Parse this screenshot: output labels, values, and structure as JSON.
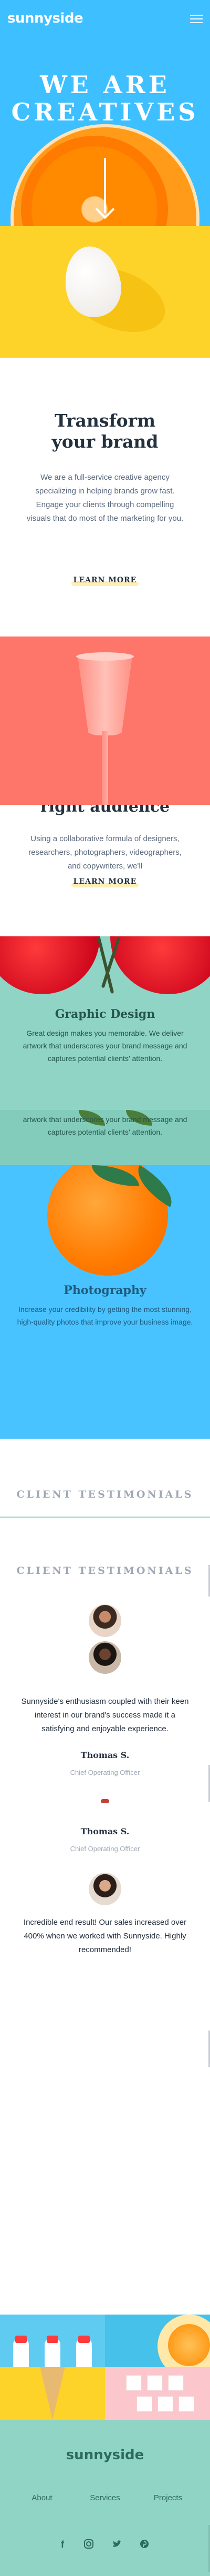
{
  "header": {
    "logo": "sunnyside"
  },
  "hero": {
    "title_line1": "WE ARE",
    "title_line2": "CREATIVES"
  },
  "transform": {
    "title_line1": "Transform",
    "title_line2": "your brand",
    "text": "We are a full-service creative agency specializing in helping brands grow fast. Engage your clients through compelling visuals that do most of the marketing for you.",
    "cta": "LEARN MORE"
  },
  "standout": {
    "title_partial": "right audience",
    "text": "Using a collaborative formula of designers, researchers, photographers, videographers, and copywriters, we'll",
    "cta": "LEARN MORE"
  },
  "graphic_design": {
    "title": "Graphic Design",
    "text": "Great design makes you memorable. We deliver artwork that underscores your brand message and captures potential clients' attention.",
    "text_repeat": "artwork that underscores your brand message and captures potential clients' attention."
  },
  "photography": {
    "title": "Photography",
    "text": "Increase your credibility by getting the most stunning, high-quality photos that improve your business image."
  },
  "testimonials": {
    "heading": "CLIENT TESTIMONIALS",
    "heading_repeat": "CLIENT TESTIMONIALS",
    "quote1": "Sunnyside's enthusiasm coupled with their keen interest in our brand's success made it a satisfying and enjoyable experience.",
    "name1": "Thomas S.",
    "role1": "Chief Operating Officer",
    "name2": "Thomas S.",
    "role2": "Chief Operating Officer",
    "quote2": "Incredible end result! Our sales increased over 400% when we worked with Sunnyside. Highly recommended!"
  },
  "footer": {
    "logo": "sunnyside",
    "nav": [
      "About",
      "Services",
      "Projects"
    ],
    "social_icons": [
      "facebook-icon",
      "instagram-icon",
      "twitter-icon",
      "pinterest-icon"
    ]
  },
  "colors": {
    "hero_bg": "#3ebfff",
    "yellow": "#fdd32a",
    "coral": "#fe7569",
    "teal": "#90d4c5",
    "photo_bg": "#49c3ff",
    "dark_text": "#24303f"
  }
}
